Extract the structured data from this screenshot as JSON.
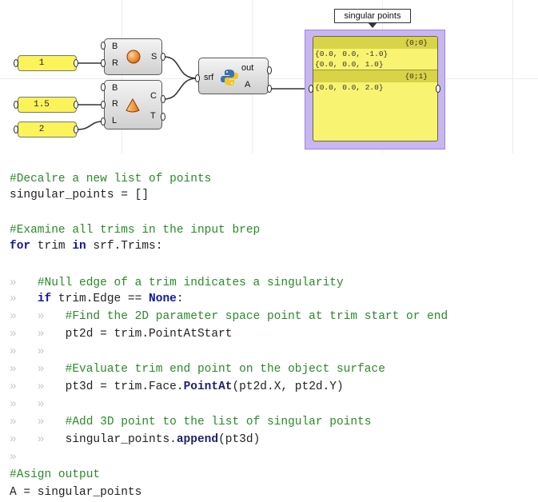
{
  "tooltip": {
    "label": "singular points"
  },
  "sliders": [
    {
      "value": "1"
    },
    {
      "value": "1.5"
    },
    {
      "value": "2"
    }
  ],
  "sphere": {
    "inputs": [
      "B",
      "R"
    ],
    "outputs": [
      "S"
    ],
    "icon": "sphere-icon"
  },
  "cone": {
    "inputs": [
      "B",
      "R",
      "L"
    ],
    "outputs": [
      "C",
      "T"
    ],
    "icon": "cone-icon"
  },
  "python": {
    "input": "srf",
    "outputs": [
      "out",
      "A"
    ],
    "icon": "python-icon"
  },
  "panel": {
    "branches": [
      {
        "path": "{0;0}",
        "items": [
          "{0.0, 0.0, -1.0}",
          "{0.0, 0.0, 1.0}"
        ]
      },
      {
        "path": "{0;1}",
        "items": [
          "{0.0, 0.0, 2.0}"
        ]
      }
    ]
  },
  "code": {
    "l01_comment": "#Decalre a new list of points",
    "l02_text": "singular_points = []",
    "l04_comment": "#Examine all trims in the input brep",
    "l05_for": "for",
    "l05_mid": " trim ",
    "l05_in": "in",
    "l05_end": " srf.Trims:",
    "l07_guide": "»   ",
    "l07_comment": "#Null edge of a trim indicates a singularity",
    "l08_guide": "»   ",
    "l08_if": "if",
    "l08_mid": " trim.Edge == ",
    "l08_none": "None",
    "l08_end": ":",
    "l09_guide": "»   »   ",
    "l09_comment": "#Find the 2D parameter space point at trim start or end",
    "l10_guide": "»   »   ",
    "l10_text": "pt2d = trim.PointAtStart",
    "l11_guide": "»   »",
    "l12_guide": "»   »   ",
    "l12_comment": "#Evaluate trim end point on the object surface",
    "l13_guide": "»   »   ",
    "l13_pre": "pt3d = trim.Face.",
    "l13_meth": "PointAt",
    "l13_post": "(pt2d.X, pt2d.Y)",
    "l14_guide": "»   »",
    "l15_guide": "»   »   ",
    "l15_comment": "#Add 3D point to the list of singular points",
    "l16_guide": "»   »   ",
    "l16_pre": "singular_points.",
    "l16_meth": "append",
    "l16_post": "(pt3d)",
    "l17_guide": "»",
    "l18_comment": "#Asign output",
    "l19_text": "A = singular_points"
  }
}
